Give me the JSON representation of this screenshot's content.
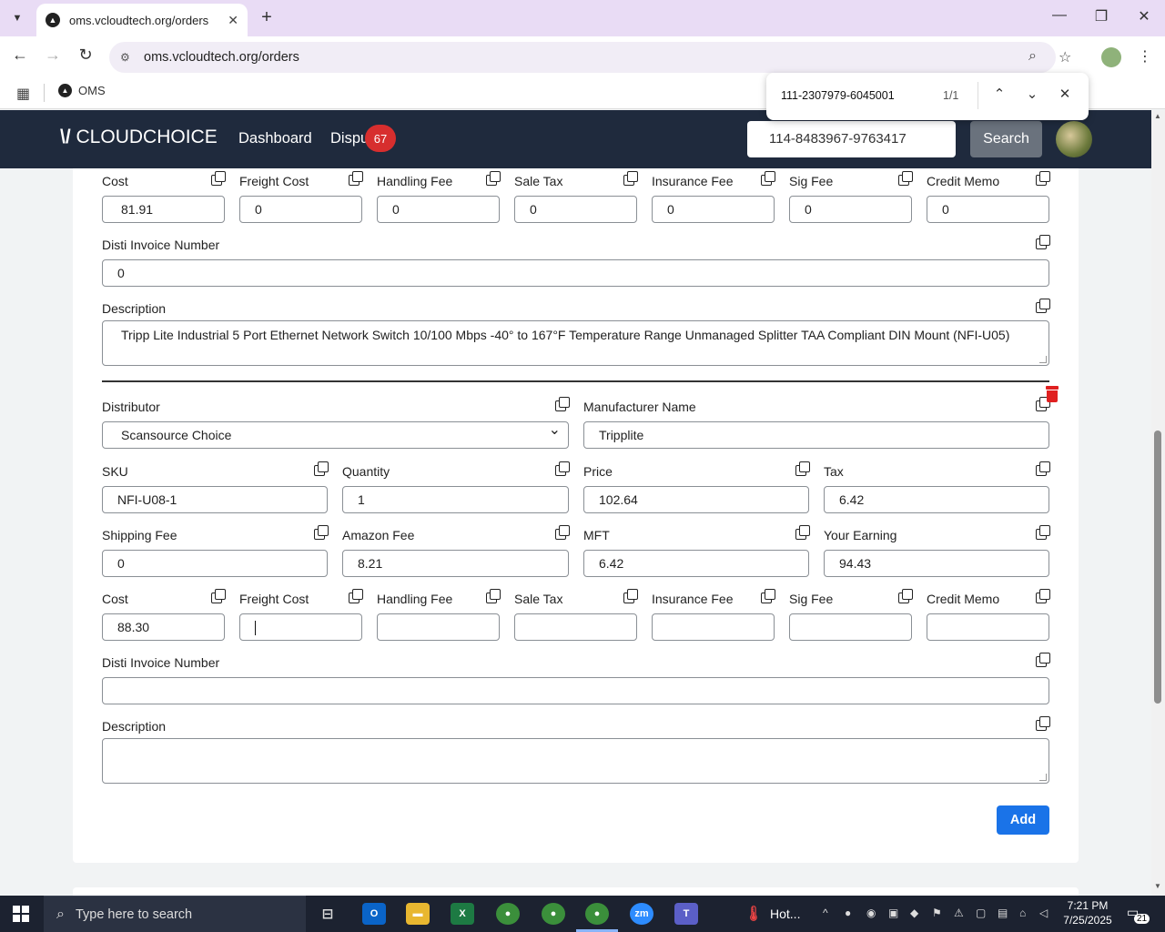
{
  "browser": {
    "tab_title": "oms.vcloudtech.org/orders",
    "url": "oms.vcloudtech.org/orders",
    "bookmark": "OMS"
  },
  "find_bar": {
    "query": "111-2307979-6045001",
    "count": "1/1"
  },
  "app_nav": {
    "logo": "CLOUDCHOICE",
    "dashboard": "Dashboard",
    "disputes": "Dispu",
    "disputes_badge": "67",
    "search_value": "114-8483967-9763417",
    "search_button": "Search"
  },
  "item1": {
    "cost_label": "Cost",
    "cost": "81.91",
    "freight_label": "Freight Cost",
    "freight": "0",
    "handling_label": "Handling Fee",
    "handling": "0",
    "sale_tax_label": "Sale Tax",
    "sale_tax": "0",
    "insurance_label": "Insurance Fee",
    "insurance": "0",
    "sig_label": "Sig Fee",
    "sig": "0",
    "credit_label": "Credit Memo",
    "credit": "0",
    "disti_label": "Disti Invoice Number",
    "disti": "0",
    "desc_label": "Description",
    "description": "Tripp Lite Industrial 5 Port Ethernet Network Switch 10/100 Mbps -40° to 167°F Temperature Range Unmanaged Splitter TAA Compliant DIN Mount (NFI-U05)"
  },
  "item2": {
    "distributor_label": "Distributor",
    "distributor": "Scansource Choice",
    "manufacturer_label": "Manufacturer Name",
    "manufacturer": "Tripplite",
    "sku_label": "SKU",
    "sku": "NFI-U08-1",
    "quantity_label": "Quantity",
    "quantity": "1",
    "price_label": "Price",
    "price": "102.64",
    "tax_label": "Tax",
    "tax": "6.42",
    "shipping_label": "Shipping Fee",
    "shipping": "0",
    "amazon_label": "Amazon Fee",
    "amazon": "8.21",
    "mft_label": "MFT",
    "mft": "6.42",
    "earning_label": "Your Earning",
    "earning": "94.43",
    "cost_label": "Cost",
    "cost": "88.30",
    "freight_label": "Freight Cost",
    "freight": "",
    "handling_label": "Handling Fee",
    "handling": "",
    "sale_tax_label": "Sale Tax",
    "sale_tax": "",
    "insurance_label": "Insurance Fee",
    "insurance": "",
    "sig_label": "Sig Fee",
    "sig": "",
    "credit_label": "Credit Memo",
    "credit": "",
    "disti_label": "Disti Invoice Number",
    "disti": "",
    "desc_label": "Description",
    "description": ""
  },
  "add_button": "Add",
  "taskbar": {
    "search_placeholder": "Type here to search",
    "hot_label": "Hot...",
    "time": "7:21 PM",
    "date": "7/25/2025",
    "notifications": "21"
  }
}
